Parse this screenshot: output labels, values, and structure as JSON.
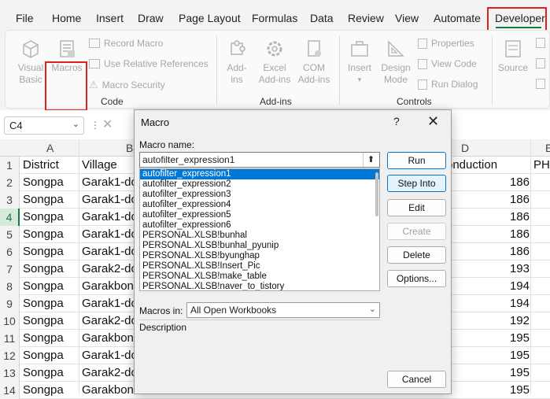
{
  "menu": {
    "items": [
      "File",
      "Home",
      "Insert",
      "Draw",
      "Page Layout",
      "Formulas",
      "Data",
      "Review",
      "View",
      "Automate",
      "Developer"
    ],
    "active": "Developer"
  },
  "ribbon": {
    "code": {
      "visual_basic": [
        "Visual",
        "Basic"
      ],
      "macros": "Macros",
      "record_macro": "Record Macro",
      "relative_refs": "Use Relative References",
      "macro_security": "Macro Security",
      "label": "Code"
    },
    "addins": {
      "addins": [
        "Add-",
        "ins"
      ],
      "excel_addins": [
        "Excel",
        "Add-ins"
      ],
      "com_addins": [
        "COM",
        "Add-ins"
      ],
      "label": "Add-ins"
    },
    "controls": {
      "insert": "Insert",
      "design_mode": [
        "Design",
        "Mode"
      ],
      "properties": "Properties",
      "view_code": "View Code",
      "run_dialog": "Run Dialog",
      "label": "Controls"
    },
    "xml": {
      "source": "Source"
    }
  },
  "namebox": {
    "value": "C4"
  },
  "grid": {
    "col_headers": [
      "A",
      "B",
      "D",
      "E"
    ],
    "rows": [
      {
        "num": "1",
        "a": "District",
        "b": "Village",
        "d": "onduction",
        "e": "PH"
      },
      {
        "num": "2",
        "a": "Songpa",
        "b": "Garak1-do",
        "d": "186",
        "e": ""
      },
      {
        "num": "3",
        "a": "Songpa",
        "b": "Garak1-do",
        "d": "186",
        "e": ""
      },
      {
        "num": "4",
        "a": "Songpa",
        "b": "Garak1-do",
        "d": "186",
        "e": ""
      },
      {
        "num": "5",
        "a": "Songpa",
        "b": "Garak1-do",
        "d": "186",
        "e": ""
      },
      {
        "num": "6",
        "a": "Songpa",
        "b": "Garak1-do",
        "d": "186",
        "e": ""
      },
      {
        "num": "7",
        "a": "Songpa",
        "b": "Garak2-do",
        "d": "193",
        "e": ""
      },
      {
        "num": "8",
        "a": "Songpa",
        "b": "Garakbon",
        "d": "194",
        "e": ""
      },
      {
        "num": "9",
        "a": "Songpa",
        "b": "Garak1-do",
        "d": "194",
        "e": ""
      },
      {
        "num": "10",
        "a": "Songpa",
        "b": "Garak2-do",
        "d": "192",
        "e": ""
      },
      {
        "num": "11",
        "a": "Songpa",
        "b": "Garakbon",
        "d": "195",
        "e": ""
      },
      {
        "num": "12",
        "a": "Songpa",
        "b": "Garak1-do",
        "d": "195",
        "e": ""
      },
      {
        "num": "13",
        "a": "Songpa",
        "b": "Garak2-do",
        "d": "195",
        "e": ""
      },
      {
        "num": "14",
        "a": "Songpa",
        "b": "Garakbon",
        "d": "195",
        "e": ""
      }
    ],
    "selected_row": "4"
  },
  "dialog": {
    "title": "Macro",
    "help": "?",
    "close": "✕",
    "macro_name_label": "Macro name:",
    "macro_name_value": "autofilter_expression1",
    "macros": [
      "autofilter_expression1",
      "autofilter_expression2",
      "autofilter_expression3",
      "autofilter_expression4",
      "autofilter_expression5",
      "autofilter_expression6",
      "PERSONAL.XLSB!bunhal",
      "PERSONAL.XLSB!bunhal_pyunip",
      "PERSONAL.XLSB!byunghap",
      "PERSONAL.XLSB!Insert_Pic",
      "PERSONAL.XLSB!make_table",
      "PERSONAL.XLSB!naver_to_tistory"
    ],
    "selected_index": 0,
    "buttons": {
      "run": "Run",
      "step_into": "Step Into",
      "edit": "Edit",
      "create": "Create",
      "delete": "Delete",
      "options": "Options...",
      "cancel": "Cancel"
    },
    "macros_in_label": "Macros in:",
    "macros_in_value": "All Open Workbooks",
    "description_label": "Description"
  },
  "colors": {
    "accent_green": "#107c41",
    "highlight_red": "#e0201e",
    "selection_blue": "#0078d7"
  }
}
